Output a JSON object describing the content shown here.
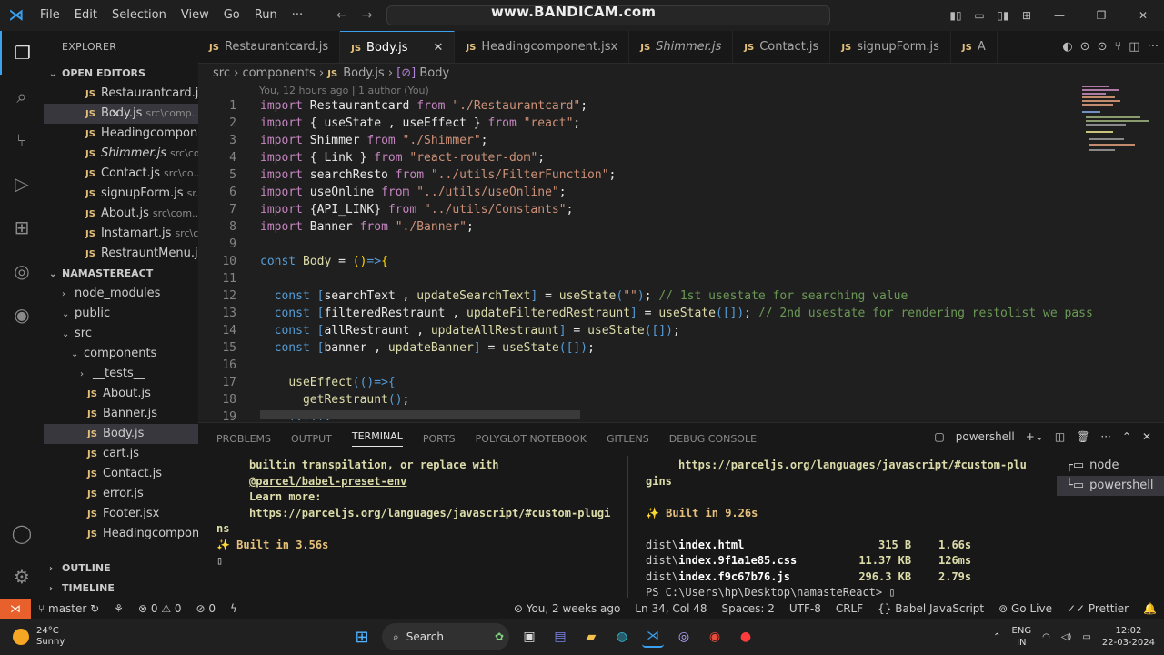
{
  "titlebar": {
    "menu": [
      "File",
      "Edit",
      "Selection",
      "View",
      "Go",
      "Run",
      "···"
    ],
    "watermark": "www.BANDICAM.com"
  },
  "explorer": {
    "title": "EXPLORER",
    "open_editors_label": "OPEN EDITORS",
    "open_editors": [
      {
        "name": "Restaurantcard.j...",
        "path": "",
        "italic": false,
        "close": false
      },
      {
        "name": "Body.js",
        "path": "src\\comp...",
        "italic": false,
        "close": true
      },
      {
        "name": "Headingcompon...",
        "path": "",
        "italic": false,
        "close": false
      },
      {
        "name": "Shimmer.js",
        "path": "src\\co...",
        "italic": true,
        "close": false
      },
      {
        "name": "Contact.js",
        "path": "src\\co...",
        "italic": false,
        "close": false
      },
      {
        "name": "signupForm.js",
        "path": "sr...",
        "italic": false,
        "close": false
      },
      {
        "name": "About.js",
        "path": "src\\com...",
        "italic": false,
        "close": false
      },
      {
        "name": "Instamart.js",
        "path": "src\\c...",
        "italic": false,
        "close": false
      },
      {
        "name": "RestrauntMenu.j...",
        "path": "",
        "italic": false,
        "close": false
      }
    ],
    "project_label": "NAMASTEREACT",
    "tree": [
      {
        "name": "node_modules",
        "type": "folder",
        "open": false
      },
      {
        "name": "public",
        "type": "folder",
        "open": true
      },
      {
        "name": "src",
        "type": "folder",
        "open": true
      },
      {
        "name": "components",
        "type": "folder",
        "open": true
      },
      {
        "name": "__tests__",
        "type": "folder",
        "open": false
      },
      {
        "name": "About.js",
        "type": "file"
      },
      {
        "name": "Banner.js",
        "type": "file"
      },
      {
        "name": "Body.js",
        "type": "file",
        "selected": true
      },
      {
        "name": "cart.js",
        "type": "file"
      },
      {
        "name": "Contact.js",
        "type": "file"
      },
      {
        "name": "error.js",
        "type": "file"
      },
      {
        "name": "Footer.jsx",
        "type": "file"
      },
      {
        "name": "Headingcomponen...",
        "type": "file"
      }
    ],
    "outline_label": "OUTLINE",
    "timeline_label": "TIMELINE"
  },
  "tabs": [
    {
      "label": "Restaurantcard.js",
      "active": false,
      "italic": false
    },
    {
      "label": "Body.js",
      "active": true,
      "italic": false
    },
    {
      "label": "Headingcomponent.jsx",
      "active": false,
      "italic": false
    },
    {
      "label": "Shimmer.js",
      "active": false,
      "italic": true
    },
    {
      "label": "Contact.js",
      "active": false,
      "italic": false
    },
    {
      "label": "signupForm.js",
      "active": false,
      "italic": false
    },
    {
      "label": "A",
      "active": false,
      "italic": false
    }
  ],
  "breadcrumb": {
    "a": "src",
    "b": "components",
    "c": "Body.js",
    "d": "Body"
  },
  "editor": {
    "blame": "You, 12 hours ago | 1 author (You)",
    "lines": [
      [
        [
          "kw",
          "import"
        ],
        [
          "id",
          " Restaurantcard "
        ],
        [
          "kw",
          "from"
        ],
        [
          "st",
          " \"./Restaurantcard\""
        ],
        [
          "id",
          ";"
        ]
      ],
      [
        [
          "kw",
          "import"
        ],
        [
          "id",
          " { useState , useEffect } "
        ],
        [
          "kw",
          "from"
        ],
        [
          "st",
          " \"react\""
        ],
        [
          "id",
          ";"
        ]
      ],
      [
        [
          "kw",
          "import"
        ],
        [
          "id",
          " Shimmer "
        ],
        [
          "kw",
          "from"
        ],
        [
          "st",
          " \"./Shimmer\""
        ],
        [
          "id",
          ";"
        ]
      ],
      [
        [
          "kw",
          "import"
        ],
        [
          "id",
          " { Link } "
        ],
        [
          "kw",
          "from"
        ],
        [
          "st",
          " \"react-router-dom\""
        ],
        [
          "id",
          ";"
        ]
      ],
      [
        [
          "kw",
          "import"
        ],
        [
          "id",
          " searchResto "
        ],
        [
          "kw",
          "from"
        ],
        [
          "st",
          " \"../utils/FilterFunction\""
        ],
        [
          "id",
          ";"
        ]
      ],
      [
        [
          "kw",
          "import"
        ],
        [
          "id",
          " useOnline "
        ],
        [
          "kw",
          "from"
        ],
        [
          "st",
          " \"../utils/useOnline\""
        ],
        [
          "id",
          ";"
        ]
      ],
      [
        [
          "kw",
          "import"
        ],
        [
          "id",
          " {API_LINK} "
        ],
        [
          "kw",
          "from"
        ],
        [
          "st",
          " \"../utils/Constants\""
        ],
        [
          "id",
          ";"
        ]
      ],
      [
        [
          "kw",
          "import"
        ],
        [
          "id",
          " Banner "
        ],
        [
          "kw",
          "from"
        ],
        [
          "st",
          " \"./Banner\""
        ],
        [
          "id",
          ";"
        ]
      ],
      [],
      [
        [
          "bl",
          "const"
        ],
        [
          "fn",
          " Body"
        ],
        [
          "id",
          " = "
        ],
        [
          "yl",
          "()"
        ],
        [
          "bl",
          "=>"
        ],
        [
          "yl",
          "{"
        ]
      ],
      [],
      [
        [
          "id",
          "  "
        ],
        [
          "bl",
          "const"
        ],
        [
          "id",
          " "
        ],
        [
          "bl",
          "["
        ],
        [
          "id",
          "searchText , "
        ],
        [
          "fn",
          "updateSearchText"
        ],
        [
          "bl",
          "]"
        ],
        [
          "id",
          " = "
        ],
        [
          "fn",
          "useState"
        ],
        [
          "bl",
          "("
        ],
        [
          "st",
          "\"\""
        ],
        [
          "bl",
          ")"
        ],
        [
          "id",
          ";"
        ],
        [
          "cm",
          " // 1st usestate for searching value"
        ]
      ],
      [
        [
          "id",
          "  "
        ],
        [
          "bl",
          "const"
        ],
        [
          "id",
          " "
        ],
        [
          "bl",
          "["
        ],
        [
          "id",
          "filteredRestraunt , "
        ],
        [
          "fn",
          "updateFilteredRestraunt"
        ],
        [
          "bl",
          "]"
        ],
        [
          "id",
          " = "
        ],
        [
          "fn",
          "useState"
        ],
        [
          "bl",
          "([])"
        ],
        [
          "id",
          ";"
        ],
        [
          "cm",
          " // 2nd usestate for rendering restolist we pass"
        ]
      ],
      [
        [
          "id",
          "  "
        ],
        [
          "bl",
          "const"
        ],
        [
          "id",
          " "
        ],
        [
          "bl",
          "["
        ],
        [
          "id",
          "allRestraunt , "
        ],
        [
          "fn",
          "updateAllRestraunt"
        ],
        [
          "bl",
          "]"
        ],
        [
          "id",
          " = "
        ],
        [
          "fn",
          "useState"
        ],
        [
          "bl",
          "([])"
        ],
        [
          "id",
          ";"
        ]
      ],
      [
        [
          "id",
          "  "
        ],
        [
          "bl",
          "const"
        ],
        [
          "id",
          " "
        ],
        [
          "bl",
          "["
        ],
        [
          "id",
          "banner , "
        ],
        [
          "fn",
          "updateBanner"
        ],
        [
          "bl",
          "]"
        ],
        [
          "id",
          " = "
        ],
        [
          "fn",
          "useState"
        ],
        [
          "bl",
          "([])"
        ],
        [
          "id",
          ";"
        ]
      ],
      [],
      [
        [
          "id",
          "    "
        ],
        [
          "fn",
          "useEffect"
        ],
        [
          "bl",
          "(()=>{"
        ]
      ],
      [
        [
          "id",
          "      "
        ],
        [
          "fn",
          "getRestraunt"
        ],
        [
          "bl",
          "()"
        ],
        [
          "id",
          ";"
        ]
      ],
      [
        [
          "id",
          "    "
        ],
        [
          "bl",
          "},[]);"
        ]
      ]
    ]
  },
  "panel": {
    "tabs": [
      "PROBLEMS",
      "OUTPUT",
      "TERMINAL",
      "PORTS",
      "POLYGLOT NOTEBOOK",
      "GITLENS",
      "DEBUG CONSOLE"
    ],
    "active_tab": "TERMINAL",
    "shell_label": "powershell",
    "left_lines": [
      "builtin transpilation, or replace with",
      "@parcel/babel-preset-env",
      "Learn more:",
      "https://parceljs.org/languages/javascript/#custom-plugi",
      "ns",
      "",
      "✨ Built in 3.56s"
    ],
    "right_lines": [
      "https://parceljs.org/languages/javascript/#custom-plu",
      "gins",
      "",
      "✨ Built in 9.26s",
      "",
      "dist\\index.html",
      "dist\\index.9f1a1e85.css",
      "dist\\index.f9c67b76.js"
    ],
    "right_sizes": [
      [
        "315 B",
        "1.66s"
      ],
      [
        "11.37 KB",
        "126ms"
      ],
      [
        "296.3 KB",
        "2.79s"
      ]
    ],
    "prompt": "PS C:\\Users\\hp\\Desktop\\namasteReact>",
    "terminals": [
      "node",
      "powershell"
    ]
  },
  "statusbar": {
    "branch": "master",
    "errors": "0",
    "warnings": "0",
    "ports": "0",
    "blame": "You, 2 weeks ago",
    "position": "Ln 34, Col 48",
    "spaces": "Spaces: 2",
    "encoding": "UTF-8",
    "eol": "CRLF",
    "language": "Babel JavaScript",
    "golive": "Go Live",
    "prettier": "Prettier"
  },
  "taskbar": {
    "temp": "24°C",
    "weather": "Sunny",
    "search": "Search",
    "lang": "ENG",
    "region": "IN",
    "time": "12:02",
    "date": "22-03-2024"
  }
}
